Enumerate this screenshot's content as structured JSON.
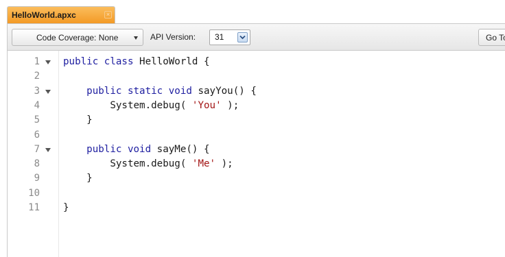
{
  "tab": {
    "label": "HelloWorld.apxc",
    "close_glyph": "×"
  },
  "toolbar": {
    "coverage_label": "Code Coverage: None",
    "api_version_label": "API Version:",
    "api_version_value": "31",
    "goto_label": "Go To"
  },
  "editor": {
    "colors": {
      "keyword": "#1e1ea0",
      "string": "#a31515",
      "text": "#1a1a1a",
      "line_number": "#8a8a8a"
    },
    "lines": [
      {
        "number": "1",
        "foldable": true,
        "tokens": [
          {
            "t": "kw",
            "v": "public class"
          },
          {
            "t": "plain",
            "v": " HelloWorld {"
          }
        ]
      },
      {
        "number": "2",
        "foldable": false,
        "tokens": []
      },
      {
        "number": "3",
        "foldable": true,
        "tokens": [
          {
            "t": "plain",
            "v": "    "
          },
          {
            "t": "kw",
            "v": "public static void"
          },
          {
            "t": "plain",
            "v": " sayYou() {"
          }
        ]
      },
      {
        "number": "4",
        "foldable": false,
        "tokens": [
          {
            "t": "plain",
            "v": "        System.debug( "
          },
          {
            "t": "str",
            "v": "'You'"
          },
          {
            "t": "plain",
            "v": " );"
          }
        ]
      },
      {
        "number": "5",
        "foldable": false,
        "tokens": [
          {
            "t": "plain",
            "v": "    }"
          }
        ]
      },
      {
        "number": "6",
        "foldable": false,
        "tokens": []
      },
      {
        "number": "7",
        "foldable": true,
        "tokens": [
          {
            "t": "plain",
            "v": "    "
          },
          {
            "t": "kw",
            "v": "public void"
          },
          {
            "t": "plain",
            "v": " sayMe() {"
          }
        ]
      },
      {
        "number": "8",
        "foldable": false,
        "tokens": [
          {
            "t": "plain",
            "v": "        System.debug( "
          },
          {
            "t": "str",
            "v": "'Me'"
          },
          {
            "t": "plain",
            "v": " );"
          }
        ]
      },
      {
        "number": "9",
        "foldable": false,
        "tokens": [
          {
            "t": "plain",
            "v": "    }"
          }
        ]
      },
      {
        "number": "10",
        "foldable": false,
        "tokens": []
      },
      {
        "number": "11",
        "foldable": false,
        "tokens": [
          {
            "t": "plain",
            "v": "}"
          }
        ]
      }
    ]
  }
}
